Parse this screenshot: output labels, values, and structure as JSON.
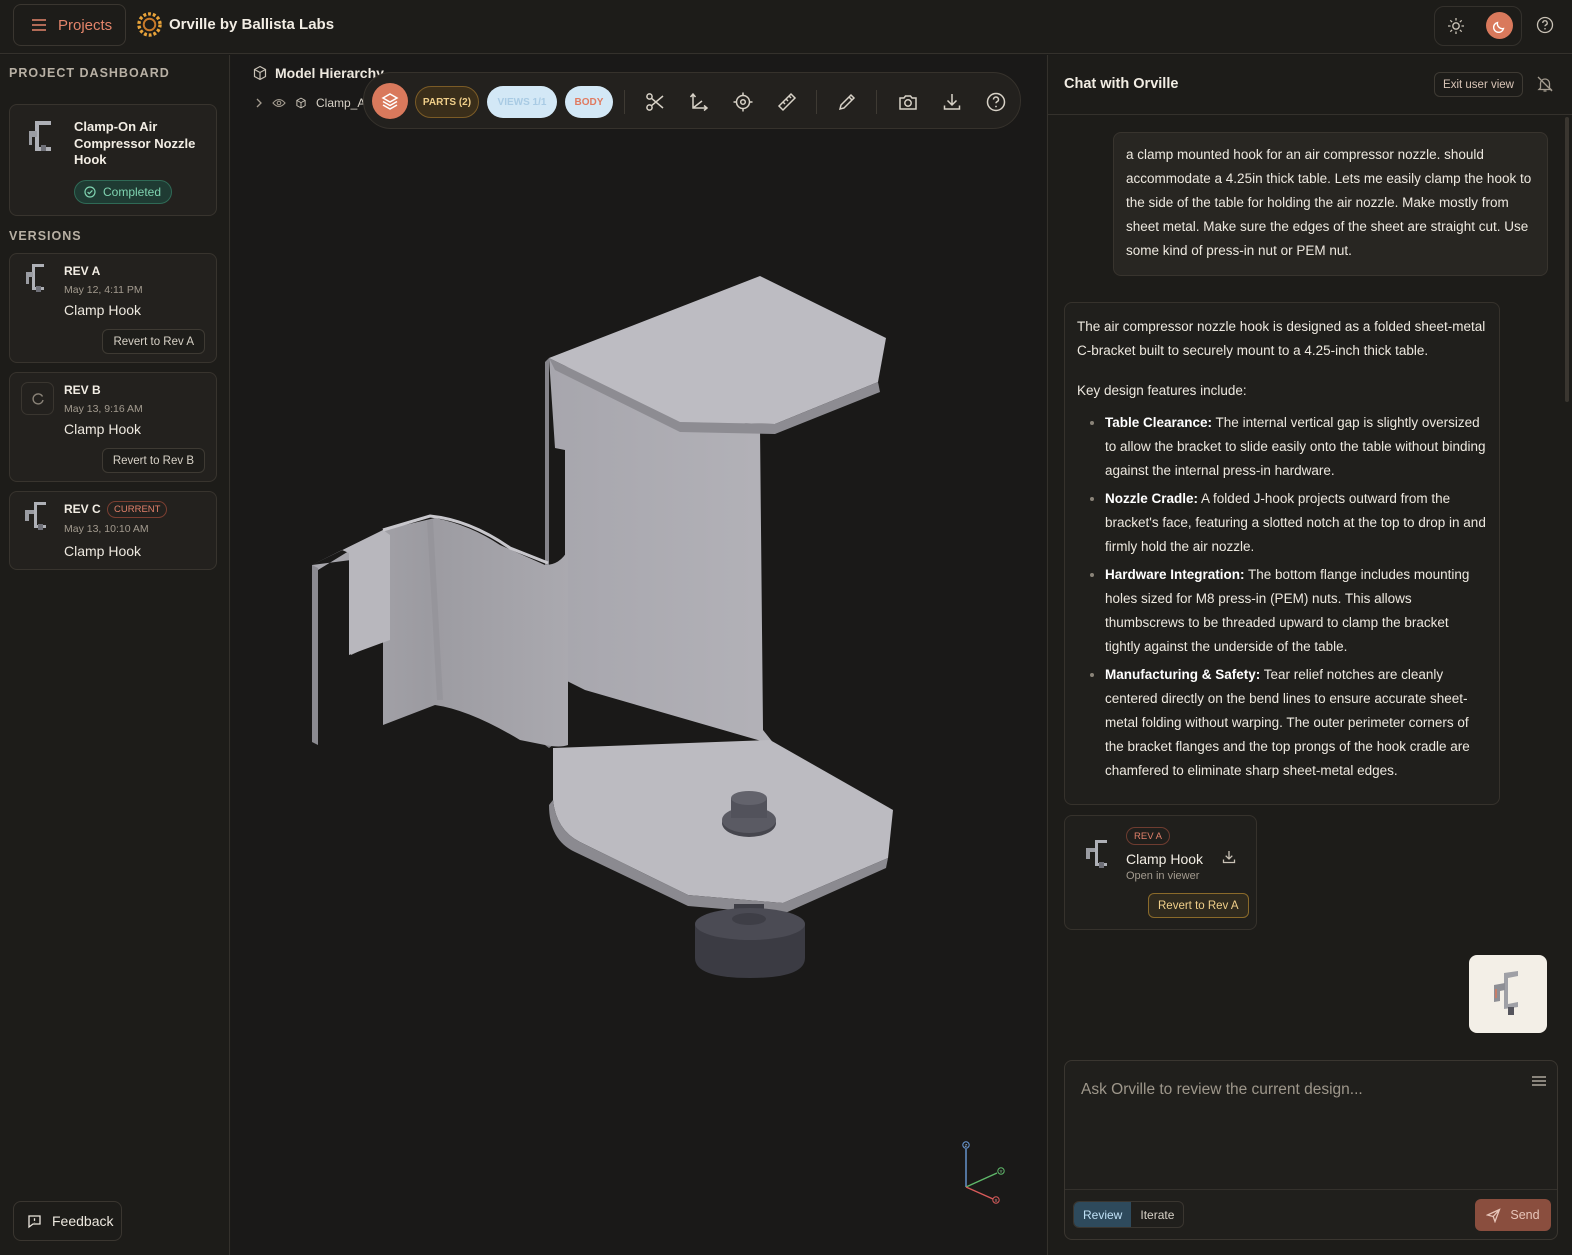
{
  "topbar": {
    "projects_label": "Projects",
    "app_title": "Orville by Ballista Labs"
  },
  "sidebar": {
    "dashboard_title": "PROJECT DASHBOARD",
    "project": {
      "title": "Clamp-On Air Compressor Nozzle Hook",
      "status": "Completed"
    },
    "versions_title": "VERSIONS",
    "versions": [
      {
        "rev": "REV A",
        "date": "May 12, 4:11 PM",
        "part": "Clamp Hook",
        "revert_label": "Revert to Rev A",
        "current": ""
      },
      {
        "rev": "REV B",
        "date": "May 13, 9:16 AM",
        "part": "Clamp Hook",
        "revert_label": "Revert to Rev B",
        "current": ""
      },
      {
        "rev": "REV C",
        "date": "May 13, 10:10 AM",
        "part": "Clamp Hook",
        "revert_label": "",
        "current": "CURRENT"
      }
    ],
    "feedback_label": "Feedback"
  },
  "viewer": {
    "hierarchy_title": "Model Hierarchy",
    "tree_item": "Clamp_A",
    "toolbar": {
      "parts_label": "PARTS (2)",
      "views_label": "VIEWS 1/1",
      "body_label": "BODY"
    },
    "axes": {
      "z": "Z",
      "y": "Y",
      "x": "X"
    }
  },
  "chat": {
    "title": "Chat with Orville",
    "exit_label": "Exit user view",
    "user_message": "a clamp mounted hook for an air compressor nozzle. should accommodate a 4.25in thick table. Lets me easily clamp the hook to the side of the table for holding the air nozzle. Make mostly from sheet metal. Make sure the edges of the sheet are straight cut. Use some kind of press-in nut or PEM nut.",
    "bot_intro": "The air compressor nozzle hook is designed as a folded sheet-metal C-bracket built to securely mount to a 4.25-inch thick table.",
    "bot_features_title": "Key design features include:",
    "bot_features": [
      {
        "title": "Table Clearance:",
        "text": " The internal vertical gap is slightly oversized to allow the bracket to slide easily onto the table without binding against the internal press-in hardware."
      },
      {
        "title": "Nozzle Cradle:",
        "text": " A folded J-hook projects outward from the bracket's face, featuring a slotted notch at the top to drop in and firmly hold the air nozzle."
      },
      {
        "title": "Hardware Integration:",
        "text": " The bottom flange includes mounting holes sized for M8 press-in (PEM) nuts. This allows thumbscrews to be threaded upward to clamp the bracket tightly against the underside of the table."
      },
      {
        "title": "Manufacturing & Safety:",
        "text": " Tear relief notches are cleanly centered directly on the bend lines to ensure accurate sheet-metal folding without warping. The outer perimeter corners of the bracket flanges and the top prongs of the hook cradle are chamfered to eliminate sharp sheet-metal edges."
      }
    ],
    "rev_card": {
      "badge": "REV A",
      "title": "Clamp Hook",
      "subtitle": "Open in viewer",
      "revert_label": "Revert to Rev A"
    },
    "input": {
      "placeholder": "Ask Orville to review the current design...",
      "mode_review": "Review",
      "mode_iterate": "Iterate",
      "send_label": "Send"
    }
  },
  "colors": {
    "accent": "#d9795c",
    "success": "#7fd3b0",
    "background": "#1b1a18",
    "panel": "#1d1c19"
  },
  "icons": [
    "menu-icon",
    "logo-icon",
    "sun-icon",
    "moon-icon",
    "help-icon",
    "cube-icon",
    "chevron-right-icon",
    "eye-icon",
    "layers-icon",
    "scissors-icon",
    "axis-icon",
    "target-icon",
    "ruler-icon",
    "pencil-icon",
    "camera-icon",
    "download-icon",
    "bell-off-icon",
    "send-icon",
    "check-circle-icon",
    "spinner-icon",
    "feedback-icon"
  ]
}
